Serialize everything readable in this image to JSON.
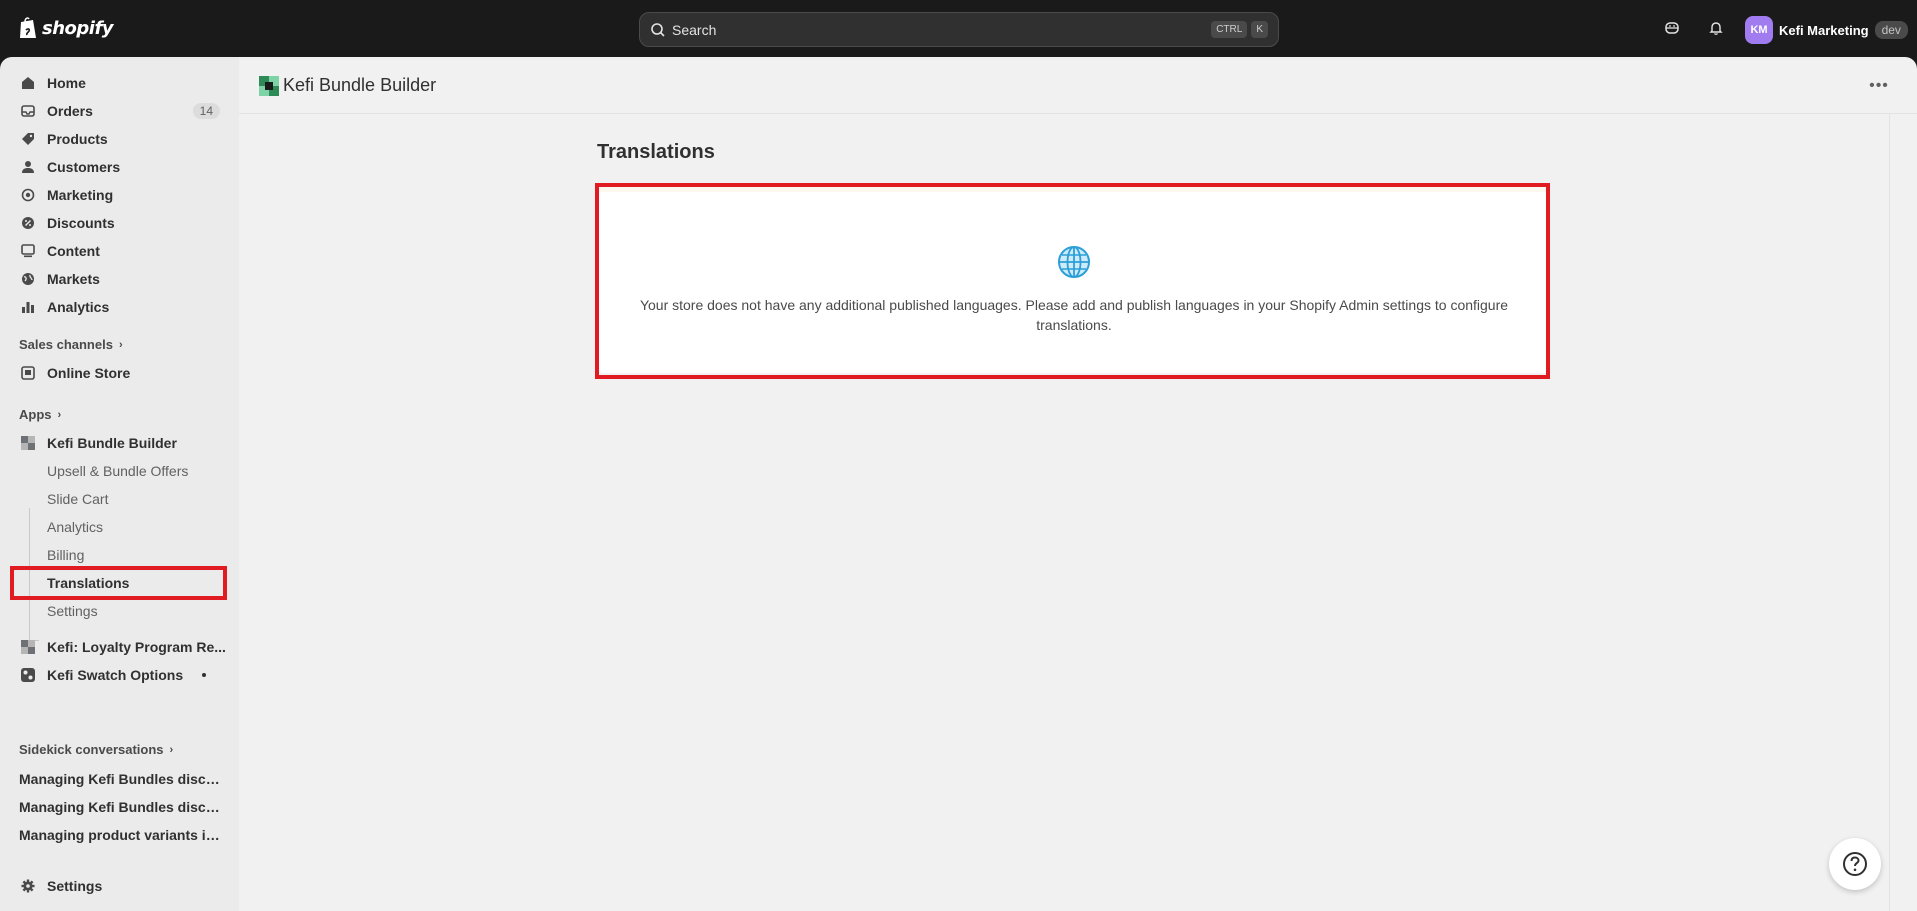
{
  "topbar": {
    "brand": "shopify",
    "search": {
      "placeholder": "Search",
      "shortcut_keys": [
        "CTRL",
        "K"
      ]
    },
    "store": {
      "initials": "KM",
      "name": "Kefi Marketing",
      "badge": "dev"
    },
    "icons": [
      "sidekick-icon",
      "bell-icon"
    ]
  },
  "sidebar": {
    "main_items": [
      {
        "label": "Home",
        "icon": "home-icon"
      },
      {
        "label": "Orders",
        "icon": "orders-icon",
        "count": "14"
      },
      {
        "label": "Products",
        "icon": "tag-icon"
      },
      {
        "label": "Customers",
        "icon": "person-icon"
      },
      {
        "label": "Marketing",
        "icon": "target-icon"
      },
      {
        "label": "Discounts",
        "icon": "discount-icon"
      },
      {
        "label": "Content",
        "icon": "content-icon"
      },
      {
        "label": "Markets",
        "icon": "globe-icon"
      },
      {
        "label": "Analytics",
        "icon": "bar-chart-icon"
      }
    ],
    "sales_channels": {
      "heading": "Sales channels",
      "items": [
        {
          "label": "Online Store",
          "icon": "store-icon"
        }
      ]
    },
    "apps": {
      "heading": "Apps",
      "app_name": "Kefi Bundle Builder",
      "sub_items": [
        "Upsell & Bundle Offers",
        "Slide Cart",
        "Analytics",
        "Billing",
        "Translations",
        "Settings"
      ],
      "active_sub_item": "Translations",
      "other_apps": [
        "Kefi: Loyalty Program Re...",
        "Kefi Swatch Options"
      ]
    },
    "sidekick": {
      "heading": "Sidekick conversations",
      "items": [
        "Managing Kefi Bundles discou...",
        "Managing Kefi Bundles discou...",
        "Managing product variants in ..."
      ]
    },
    "settings_label": "Settings"
  },
  "main": {
    "app_title": "Kefi Bundle Builder",
    "page_title": "Translations",
    "empty_state_message": "Your store does not have any additional published languages. Please add and publish languages in your Shopify Admin settings to configure translations.",
    "more_label": "•••"
  },
  "colors": {
    "highlight": "#e01b22",
    "avatar": "#a07cf0",
    "globe": "#2a9fd8"
  }
}
